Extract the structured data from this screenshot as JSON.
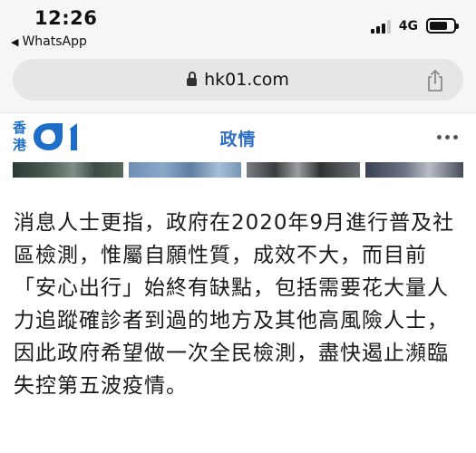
{
  "status_bar": {
    "time": "12:26",
    "back_app": "WhatsApp",
    "network": "4G",
    "signal_bars": 3,
    "battery_level": 0.75
  },
  "browser": {
    "url": "hk01.com"
  },
  "site": {
    "logo_chars": [
      "香",
      "港"
    ],
    "section_title": "政情",
    "brand_color": "#1c6ec8"
  },
  "article": {
    "paragraph": "消息人士更指，政府在2020年9月進行普及社區檢測，惟屬自願性質，成效不大，而目前「安心出行」始終有缺點，包括需要花大量人力追蹤確診者到過的地方及其他高風險人士，因此政府希望做一次全民檢測，盡快遏止瀕臨失控第五波疫情。"
  },
  "icons": [
    "back-triangle-icon",
    "signal-icon",
    "battery-icon",
    "lock-icon",
    "share-icon",
    "more-icon"
  ]
}
